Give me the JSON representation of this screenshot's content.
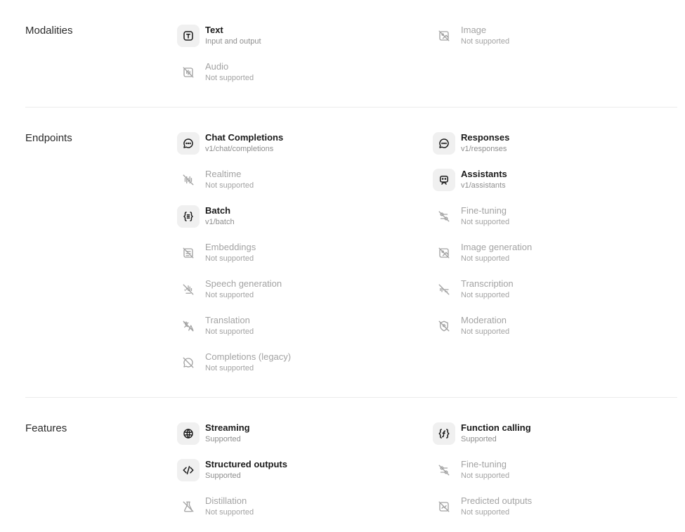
{
  "modalities": {
    "title": "Modalities",
    "items": [
      {
        "title": "Text",
        "subtitle": "Input and output",
        "icon": "text-icon",
        "supported": true
      },
      {
        "title": "Image",
        "subtitle": "Not supported",
        "icon": "image-off-icon",
        "supported": false
      },
      {
        "title": "Audio",
        "subtitle": "Not supported",
        "icon": "audio-off-icon",
        "supported": false
      }
    ]
  },
  "endpoints": {
    "title": "Endpoints",
    "items": [
      {
        "title": "Chat Completions",
        "subtitle": "v1/chat/completions",
        "icon": "chat-icon",
        "supported": true
      },
      {
        "title": "Responses",
        "subtitle": "v1/responses",
        "icon": "chat-icon",
        "supported": true
      },
      {
        "title": "Realtime",
        "subtitle": "Not supported",
        "icon": "realtime-off-icon",
        "supported": false
      },
      {
        "title": "Assistants",
        "subtitle": "v1/assistants",
        "icon": "assistant-icon",
        "supported": true
      },
      {
        "title": "Batch",
        "subtitle": "v1/batch",
        "icon": "batch-icon",
        "supported": true
      },
      {
        "title": "Fine-tuning",
        "subtitle": "Not supported",
        "icon": "fine-tuning-off-icon",
        "supported": false
      },
      {
        "title": "Embeddings",
        "subtitle": "Not supported",
        "icon": "embeddings-off-icon",
        "supported": false
      },
      {
        "title": "Image generation",
        "subtitle": "Not supported",
        "icon": "image-off-icon",
        "supported": false
      },
      {
        "title": "Speech generation",
        "subtitle": "Not supported",
        "icon": "speech-off-icon",
        "supported": false
      },
      {
        "title": "Transcription",
        "subtitle": "Not supported",
        "icon": "transcription-off-icon",
        "supported": false
      },
      {
        "title": "Translation",
        "subtitle": "Not supported",
        "icon": "translation-off-icon",
        "supported": false
      },
      {
        "title": "Moderation",
        "subtitle": "Not supported",
        "icon": "moderation-off-icon",
        "supported": false
      },
      {
        "title": "Completions (legacy)",
        "subtitle": "Not supported",
        "icon": "completions-off-icon",
        "supported": false
      }
    ]
  },
  "features": {
    "title": "Features",
    "items": [
      {
        "title": "Streaming",
        "subtitle": "Supported",
        "icon": "streaming-icon",
        "supported": true
      },
      {
        "title": "Function calling",
        "subtitle": "Supported",
        "icon": "function-icon",
        "supported": true
      },
      {
        "title": "Structured outputs",
        "subtitle": "Supported",
        "icon": "code-icon",
        "supported": true
      },
      {
        "title": "Fine-tuning",
        "subtitle": "Not supported",
        "icon": "fine-tuning-off-icon",
        "supported": false
      },
      {
        "title": "Distillation",
        "subtitle": "Not supported",
        "icon": "distillation-off-icon",
        "supported": false
      },
      {
        "title": "Predicted outputs",
        "subtitle": "Not supported",
        "icon": "predicted-off-icon",
        "supported": false
      }
    ]
  }
}
